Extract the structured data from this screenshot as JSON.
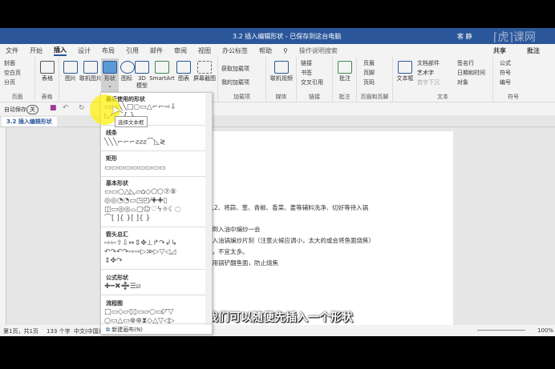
{
  "window": {
    "title": "3.2 插入编辑形状 - 已保存到这台电脑",
    "user": "客 静",
    "watermark": "虎课网"
  },
  "tabs": [
    "文件",
    "开始",
    "插入",
    "设计",
    "布局",
    "引用",
    "邮件",
    "审阅",
    "视图",
    "办公标签",
    "帮助"
  ],
  "active_tab": "插入",
  "search": "操作说明搜索",
  "share": "共享",
  "comment_btn": "批注",
  "ribbon": {
    "pages": {
      "items": [
        "封面",
        "空白页",
        "分页"
      ],
      "label": "页面"
    },
    "table": {
      "btn": "表格",
      "label": "表格"
    },
    "illustrations": {
      "items": [
        "图片",
        "联机图片",
        "形状",
        "图标",
        "3D 模型",
        "SmartArt",
        "图表",
        "屏幕截图"
      ]
    },
    "addins": {
      "items": [
        "获取加载项",
        "我的加载项"
      ],
      "label": "加载项"
    },
    "media": {
      "btn": "联机视频",
      "label": "媒体"
    },
    "links": {
      "items": [
        "链接",
        "书签",
        "交叉引用"
      ],
      "label": "链接"
    },
    "comments": {
      "btn": "批注",
      "label": "批注"
    },
    "header_footer": {
      "items": [
        "页眉",
        "页脚",
        "页码"
      ],
      "label": "页眉和页脚"
    },
    "text": {
      "btn": "文本框",
      "items": [
        "文档部件",
        "艺术字",
        "首字下沉",
        "签名行",
        "日期和时间",
        "对象"
      ],
      "label": "文本"
    },
    "symbols": {
      "items": [
        "公式",
        "符号",
        "编号"
      ],
      "label": "符号"
    }
  },
  "qat": {
    "autosave": "自动保存",
    "toggle": "关"
  },
  "doc_tab": "3.2 插入编辑形状",
  "document": {
    "lines": [
      "净,2、将蒜、葱、青椒、香菜、姜等辅料洗净、切好等待入锅",
      "姜倒入油中煸炒一会",
      "放入油锅煸炒片刻（注意火候应调小，太大的或会将鱼面烧焦）",
      "腥，不宜太多。",
      "再用锅铲翻鱼面，防止烧焦"
    ]
  },
  "subtitle": "我们可以随便先插入一个形状",
  "shapes_menu": {
    "sections": [
      {
        "title": "最近使用的形状",
        "rows": [
          "▭▭╲╲□○▭△⌐⌐⇨⇩",
          "◺↶⌒{ }"
        ]
      },
      {
        "title": "线条",
        "rows": [
          "╲╲╲⌐⌐⌐ƨƨƨ⌒◺≷"
        ]
      },
      {
        "title": "矩形",
        "rows": [
          "▭▭▭▭▭▭▭▭▭"
        ]
      },
      {
        "title": "基本形状",
        "rows": [
          "▭▭○△◺▱⌂◇⬠⬡⑦⑧",
          "◎◎◔◔▭◳◰⁄✚✚▯",
          "◫▭◎◎⌓▢☺♡ϟ☼☾◌",
          "⌒[ ]{ }[ ]{ }"
        ]
      },
      {
        "title": "箭头总汇",
        "rows": [
          "⇨⇦⇧⇩⇔⇕✥⊥↱↷↲↳",
          "↶↷↶↷⇨⇨▷≫▷▽◁◿",
          "⇕✥↷"
        ]
      },
      {
        "title": "公式形状",
        "rows": [
          "✚━✖➗☰⧄"
        ]
      },
      {
        "title": "流程图",
        "rows": [
          "□▭◇▱▯▯▭▱○▭◸▽",
          "○▭△▭⊗⊕⧗◇△▽◁▷"
        ]
      }
    ],
    "new_canvas": "新建画布(N)",
    "tooltip": "选择文本框"
  },
  "status": {
    "page": "第1页，共1页",
    "words": "133 个字",
    "lang": "中文(中国)",
    "zoom": "100%"
  }
}
